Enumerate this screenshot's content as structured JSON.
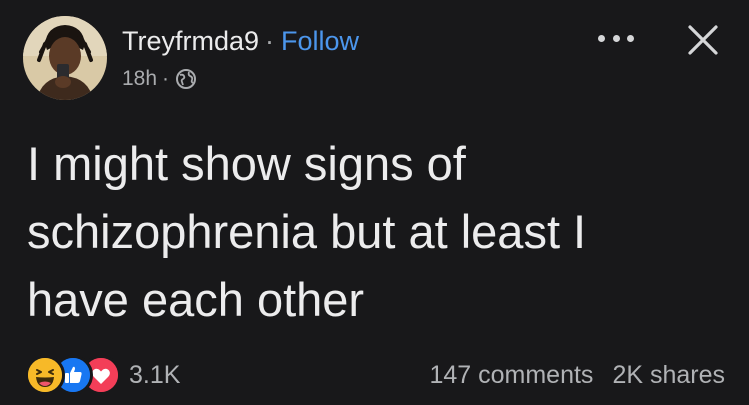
{
  "author": {
    "name": "Treyfrmda9",
    "separator": "·",
    "follow_label": "Follow"
  },
  "meta": {
    "time": "18h",
    "separator": "·",
    "audience_icon": "globe-icon"
  },
  "toolbar": {
    "more_icon": "more-horizontal-icon",
    "close_icon": "close-icon"
  },
  "post": {
    "lines": [
      "I might show signs of",
      "schizophrenia but at least I",
      "have each other"
    ]
  },
  "reactions": {
    "icons": [
      "haha-reaction-icon",
      "like-reaction-icon",
      "love-reaction-icon"
    ],
    "count": "3.1K"
  },
  "stats": {
    "comments": "147 comments",
    "shares": "2K shares"
  },
  "colors": {
    "background": "#18181a",
    "link": "#4c96ec",
    "like": "#1877f2",
    "love": "#f33e58",
    "haha": "#f7b928"
  }
}
